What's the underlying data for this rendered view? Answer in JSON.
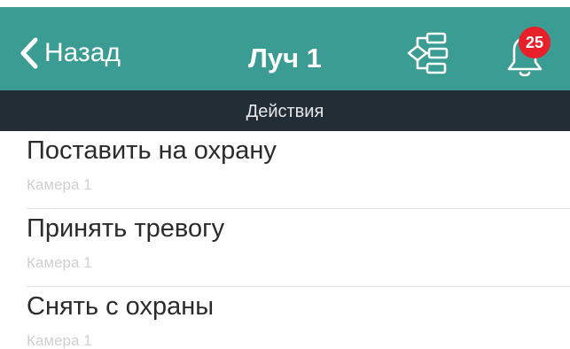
{
  "navbar": {
    "back_label": "Назад",
    "title": "Луч 1",
    "alarm_count": "25",
    "background_color": "#3a9c92",
    "badge_color": "#e8202a",
    "icons": [
      "chevron-left-icon",
      "scheme-icon",
      "bell-icon"
    ]
  },
  "section": {
    "title": "Действия",
    "background_color": "#232d36"
  },
  "actions": [
    {
      "title": "Поставить на охрану",
      "subtitle": "Камера 1"
    },
    {
      "title": "Принять тревогу",
      "subtitle": "Камера 1"
    },
    {
      "title": "Снять с охраны",
      "subtitle": "Камера 1"
    }
  ]
}
